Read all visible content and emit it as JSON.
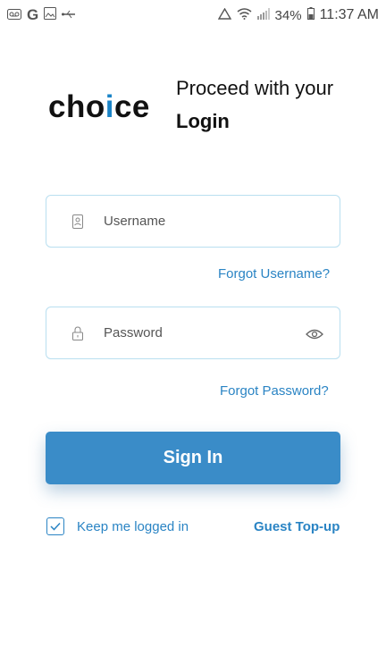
{
  "statusbar": {
    "google": "G",
    "battery": "34%",
    "time": "11:37 AM"
  },
  "brand": {
    "logo_pre": "cho",
    "logo_i": "i",
    "logo_post": "ce"
  },
  "heading": {
    "line1": "Proceed with your",
    "line2": "Login"
  },
  "form": {
    "username_placeholder": "Username",
    "forgot_username": "Forgot Username?",
    "password_placeholder": "Password",
    "forgot_password": "Forgot Password?",
    "signin_label": "Sign In",
    "keep_logged_in": "Keep me logged in",
    "keep_logged_in_checked": true,
    "guest_topup": "Guest Top-up"
  },
  "colors": {
    "accent": "#2a84c4",
    "button": "#3a8cc8",
    "field_border": "#b9dff0"
  }
}
